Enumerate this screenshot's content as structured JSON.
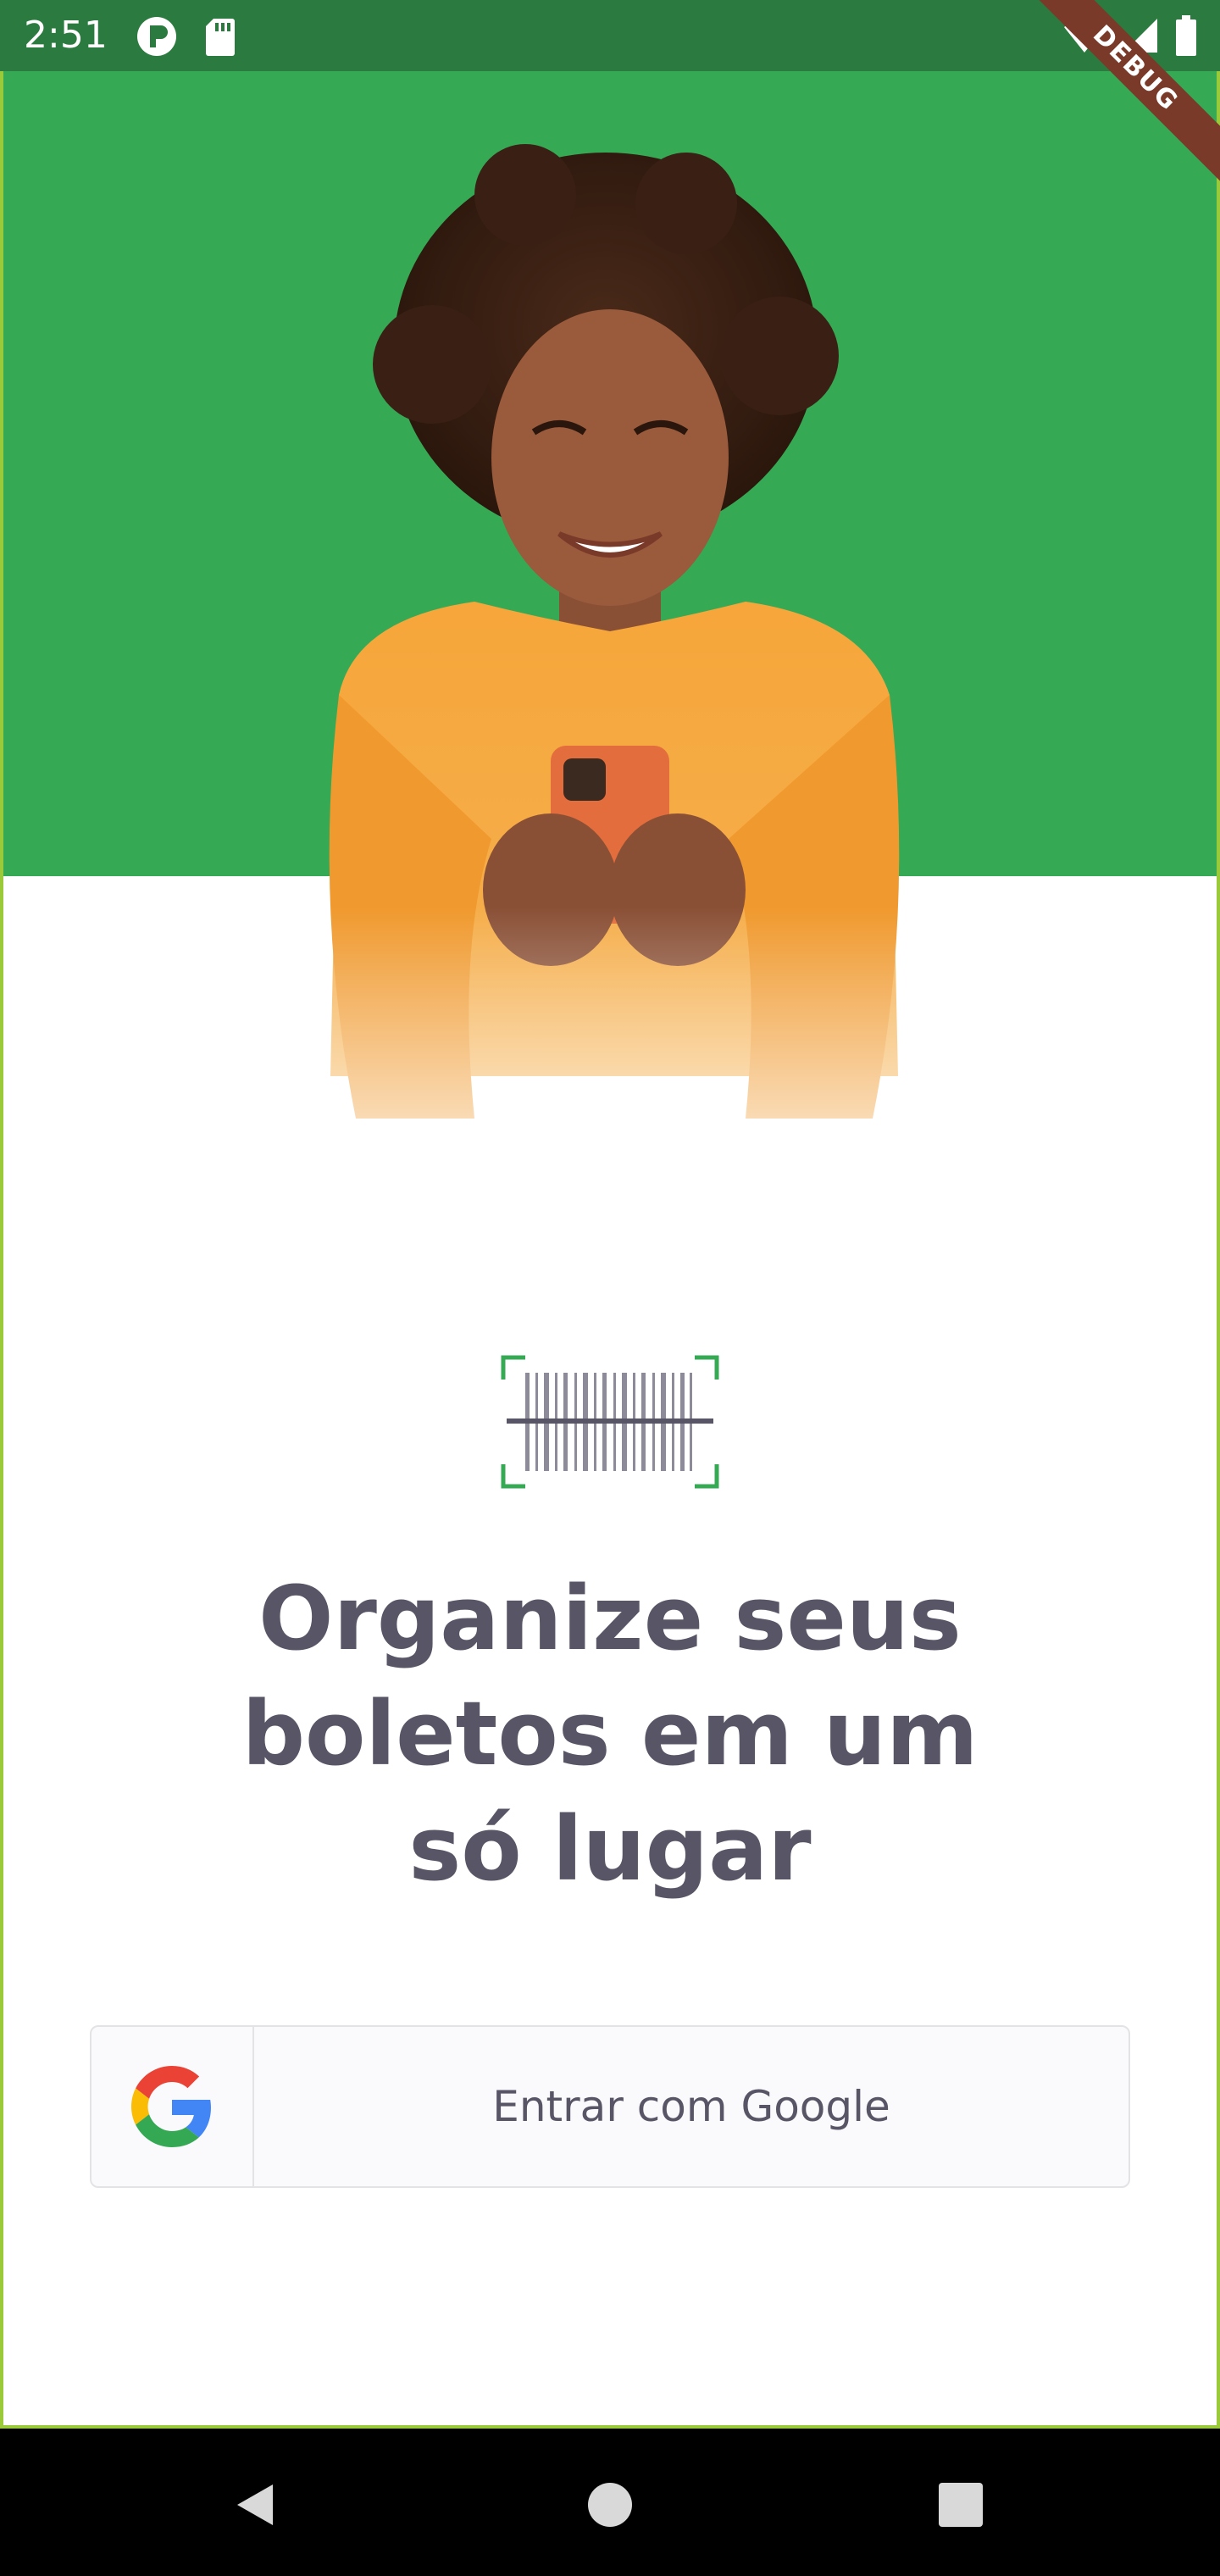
{
  "status_bar": {
    "time": "2:51",
    "left_icons": [
      "notification-p-icon",
      "sd-card-icon"
    ],
    "right_icons": [
      "wifi-icon",
      "signal-icon",
      "battery-icon"
    ]
  },
  "debug_banner": "DEBUG",
  "hero": {
    "background_color": "#35a954",
    "image": "woman-with-phone-illustration"
  },
  "logo": "barcode-scan-icon",
  "headline": {
    "line1": "Organize seus",
    "line2": "boletos em um",
    "line3": "só lugar"
  },
  "login": {
    "google_button_label": "Entrar com Google",
    "icon": "google-icon"
  },
  "nav_bar": {
    "buttons": [
      "back-icon",
      "home-icon",
      "recents-icon"
    ]
  },
  "colors": {
    "primary_green": "#35a954",
    "status_bar": "#2b7a3f",
    "heading": "#585666",
    "button_bg": "#fafafc",
    "button_border": "#e3e3e6",
    "debug_ribbon": "#7a3a2a"
  }
}
